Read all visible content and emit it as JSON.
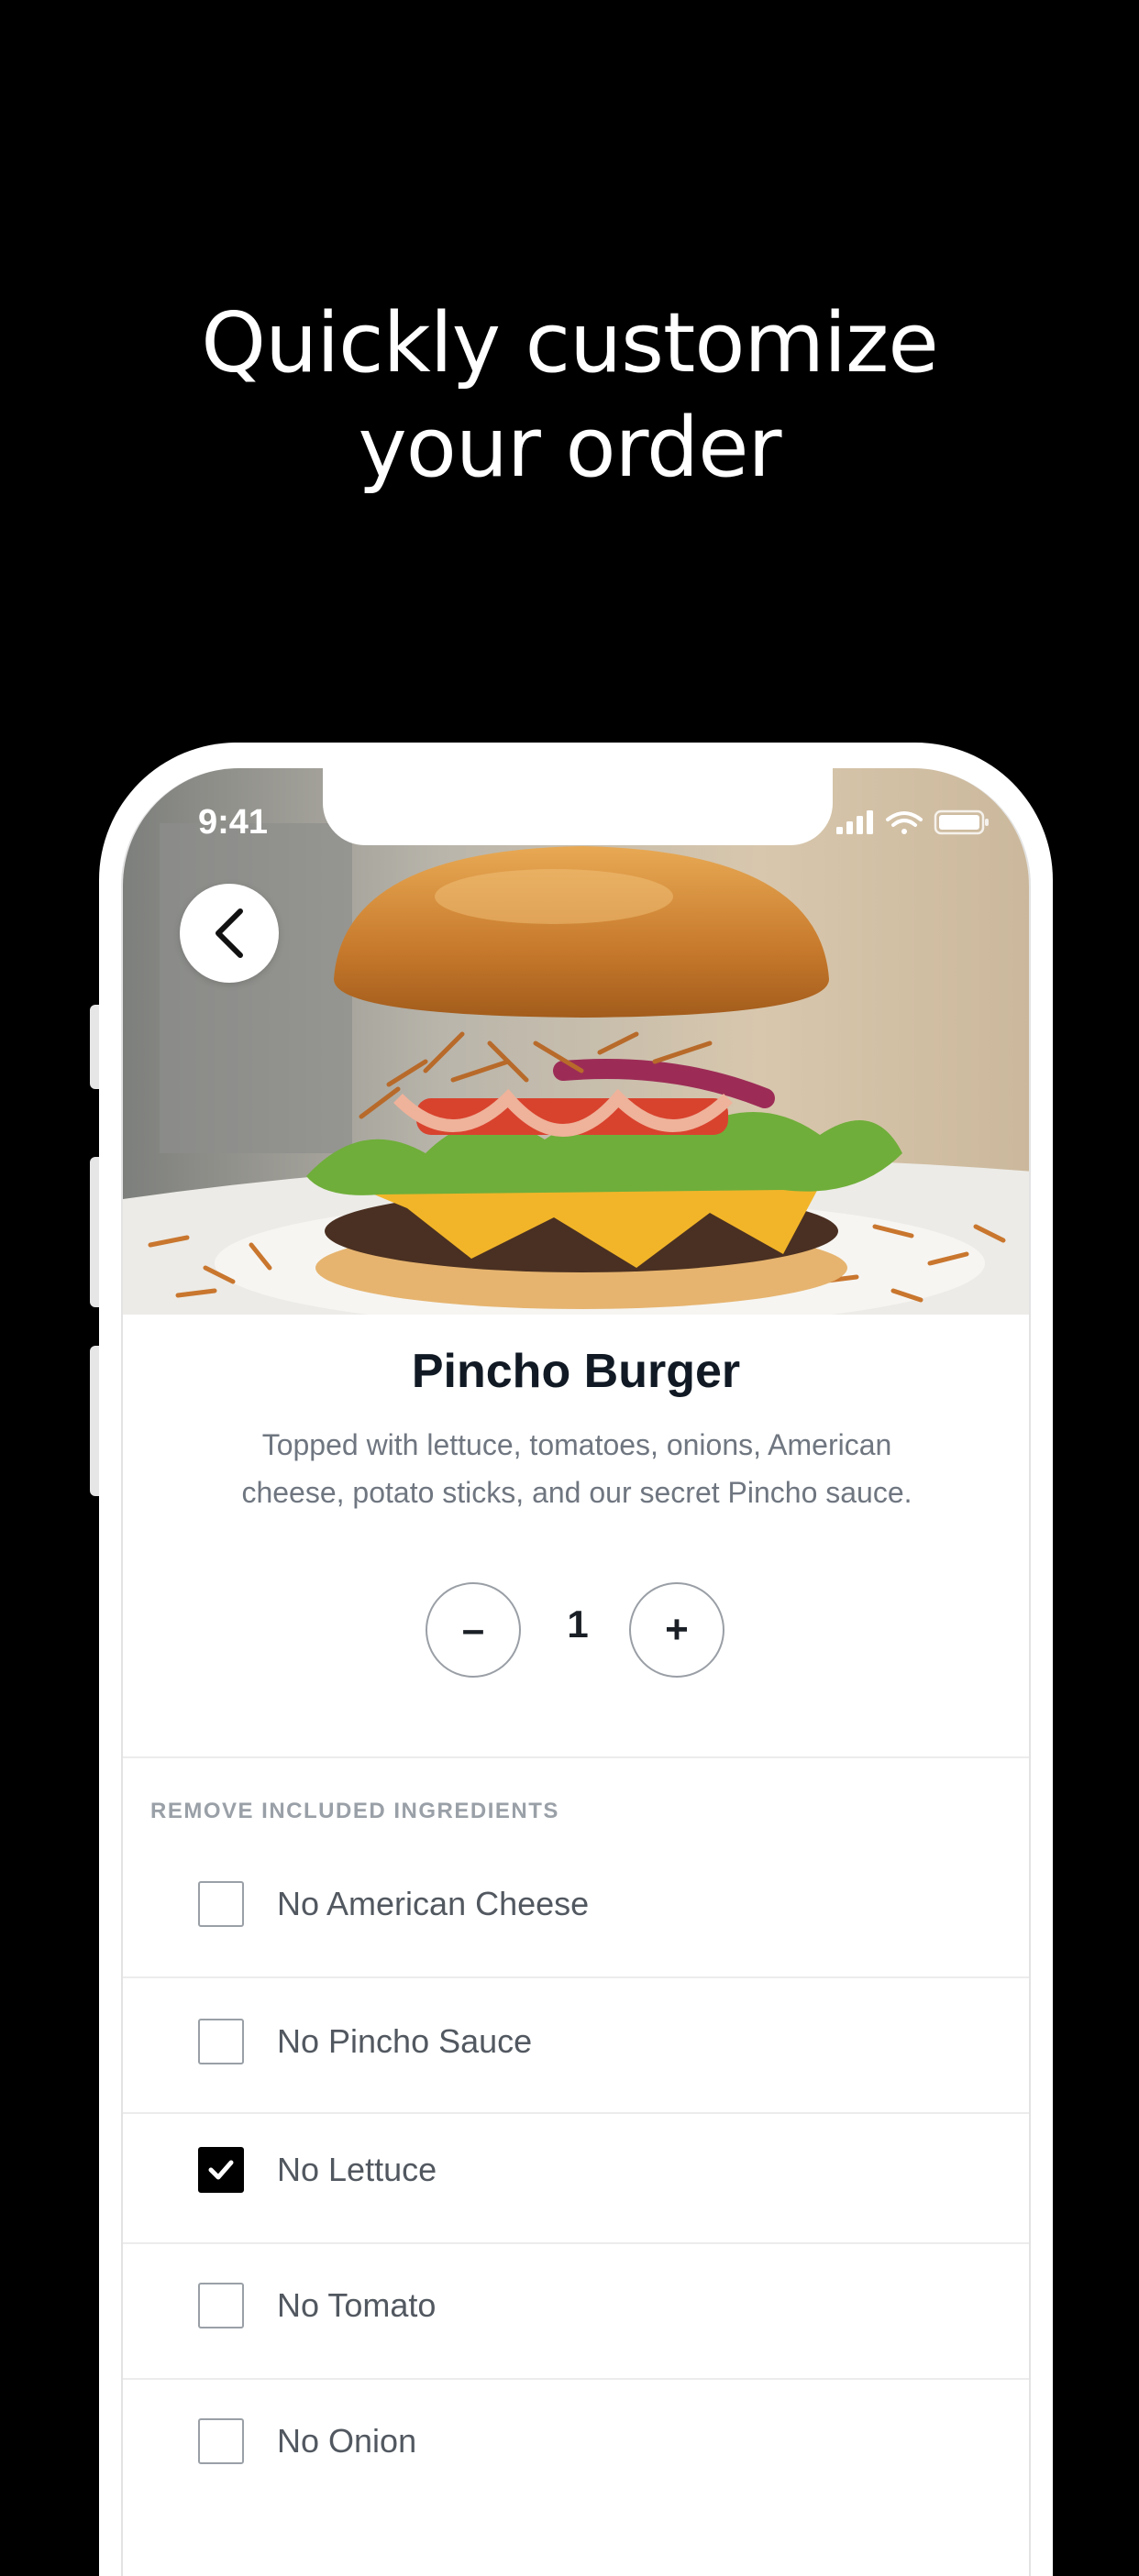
{
  "headline": {
    "line1": "Quickly customize",
    "line2": "your order"
  },
  "status_bar": {
    "time": "9:41"
  },
  "product": {
    "name": "Pincho Burger",
    "description": "Topped with lettuce, tomatoes, onions, American cheese, potato sticks, and our secret Pincho sauce."
  },
  "quantity": {
    "minus": "–",
    "value": "1",
    "plus": "+"
  },
  "section": {
    "title": "REMOVE INCLUDED INGREDIENTS"
  },
  "options": [
    {
      "label": "No American Cheese",
      "checked": false
    },
    {
      "label": "No Pincho Sauce",
      "checked": false
    },
    {
      "label": "No Lettuce",
      "checked": true
    },
    {
      "label": "No Tomato",
      "checked": false
    },
    {
      "label": "No Onion",
      "checked": false
    }
  ],
  "icons": {
    "back": "chevron-left-icon",
    "signal": "signal-icon",
    "wifi": "wifi-icon",
    "battery": "battery-icon"
  }
}
